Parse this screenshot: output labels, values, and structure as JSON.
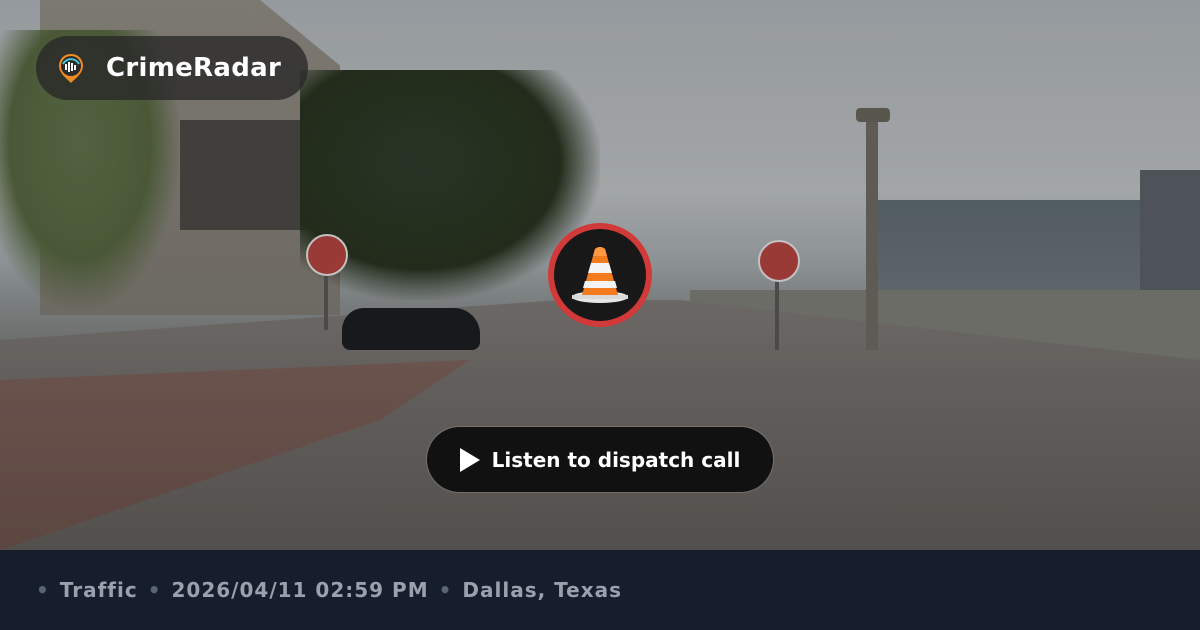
{
  "brand": {
    "name": "CrimeRadar",
    "logo_icon": "radar-pin-icon",
    "accent": "#f08a24"
  },
  "incident": {
    "icon": "traffic-cone-icon",
    "badge_color": "#d23a3a"
  },
  "action": {
    "label": "Listen to dispatch call",
    "icon": "play-icon"
  },
  "meta": {
    "category": "Traffic",
    "datetime": "2026/04/11 02:59 PM",
    "location": "Dallas, Texas"
  }
}
